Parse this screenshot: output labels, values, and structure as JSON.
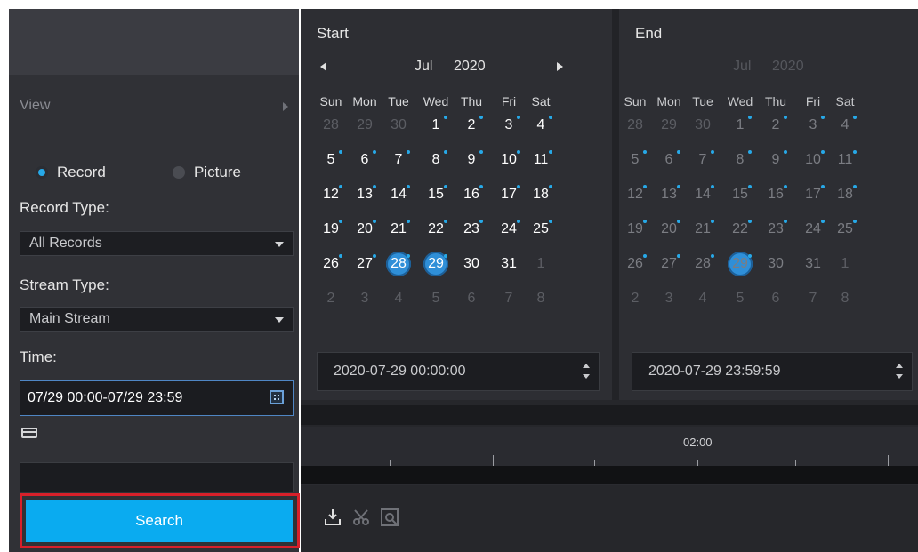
{
  "sidebar": {
    "view_label": "View",
    "record_radio": "Record",
    "picture_radio": "Picture",
    "record_type_label": "Record Type:",
    "record_type_value": "All Records",
    "stream_type_label": "Stream Type:",
    "stream_type_value": "Main Stream",
    "time_label": "Time:",
    "time_value": "07/29 00:00-07/29 23:59",
    "card_number_value": "",
    "search_button": "Search"
  },
  "calendar_start": {
    "title": "Start",
    "month": "Jul",
    "year": "2020",
    "selected_days": [
      28,
      29
    ],
    "datetime_value": "2020-07-29 00:00:00"
  },
  "calendar_end": {
    "title": "End",
    "month": "Jul",
    "year": "2020",
    "selected_days": [
      29
    ],
    "datetime_value": "2020-07-29 23:59:59"
  },
  "weekdays": [
    "Sun",
    "Mon",
    "Tue",
    "Wed",
    "Thu",
    "Fri",
    "Sat"
  ],
  "calendar_weeks": [
    [
      "28",
      "29",
      "30",
      "1",
      "2",
      "3",
      "4"
    ],
    [
      "5",
      "6",
      "7",
      "8",
      "9",
      "10",
      "11"
    ],
    [
      "12",
      "13",
      "14",
      "15",
      "16",
      "17",
      "18"
    ],
    [
      "19",
      "20",
      "21",
      "22",
      "23",
      "24",
      "25"
    ],
    [
      "26",
      "27",
      "28",
      "29",
      "30",
      "31",
      "1"
    ],
    [
      "2",
      "3",
      "4",
      "5",
      "6",
      "7",
      "8"
    ]
  ],
  "record_dot_days": [
    1,
    2,
    3,
    4,
    5,
    6,
    7,
    8,
    9,
    10,
    11,
    12,
    13,
    14,
    15,
    16,
    17,
    18,
    19,
    20,
    21,
    22,
    23,
    24,
    25,
    26,
    27,
    28,
    29
  ],
  "timeline": {
    "label": "02:00"
  },
  "toolbar_icons": [
    "download-icon",
    "clip-icon",
    "snapshot-icon"
  ],
  "colors": {
    "accent": "#0aabf0",
    "highlight_border": "#d8202a",
    "record_dot": "#27a9e8",
    "selected_day": "#2f8fd8"
  }
}
